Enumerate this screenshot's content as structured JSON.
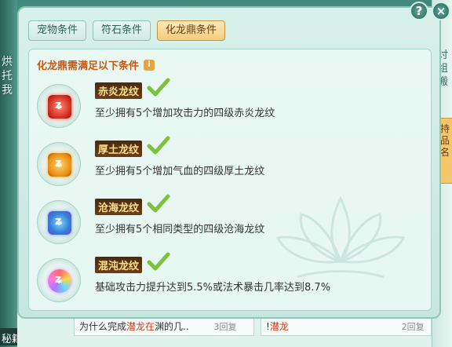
{
  "tabs": [
    {
      "label": "宠物条件",
      "active": false
    },
    {
      "label": "符石条件",
      "active": false
    },
    {
      "label": "化龙鼎条件",
      "active": true
    }
  ],
  "heading": "化龙鼎需满足以下条件",
  "conditions": [
    {
      "icon": "red-gem-icon",
      "title": "赤炎龙纹",
      "description": "至少拥有5个增加攻击力的四级赤炎龙纹",
      "met": true
    },
    {
      "icon": "orange-gem-icon",
      "title": "厚土龙纹",
      "description": "至少拥有5个增加气血的四级厚土龙纹",
      "met": true
    },
    {
      "icon": "blue-gem-icon",
      "title": "沧海龙纹",
      "description": "至少拥有5个相同类型的四级沧海龙纹",
      "met": true
    },
    {
      "icon": "rainbow-gem-icon",
      "title": "混沌龙纹",
      "description": "基础攻击力提升达到5.5%或法术暴击几率达到8.7%",
      "met": true
    }
  ],
  "left_strip": {
    "vertical_text": "烘托我",
    "badge": "秘籍"
  },
  "right_strip": {
    "vertical_text": "讨组搬",
    "tab_text": "持品名"
  },
  "bottom_list": [
    {
      "prefix": "为什么完成",
      "highlight": "潜龙在",
      "suffix": "渊的几..",
      "reply": "3回复"
    },
    {
      "prefix": "!",
      "highlight": "潜龙",
      "suffix": "",
      "reply": "2回复"
    }
  ],
  "buttons": {
    "help": "?",
    "close": "×"
  },
  "colors": {
    "accent": "#c25a17",
    "check": "#7cc23a",
    "active_tab": "#f1cd7c"
  }
}
